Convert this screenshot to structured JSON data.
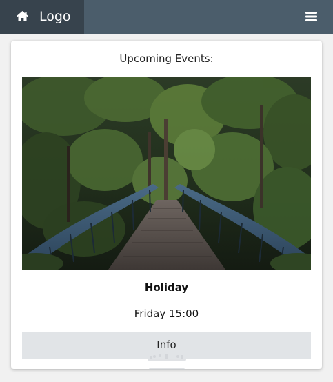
{
  "header": {
    "logo_label": "Logo",
    "logo_icon": "home-icon",
    "menu_icon": "hamburger-menu-icon",
    "background": "#4b5d6b",
    "logo_background": "#37434d"
  },
  "events": {
    "heading": "Upcoming Events:",
    "item": {
      "image_alt": "forest-bridge-photo",
      "title": "Holiday",
      "time": "Friday 15:00",
      "button_label": "Info"
    }
  },
  "watermark": {
    "brand": "mostaql-logo"
  }
}
